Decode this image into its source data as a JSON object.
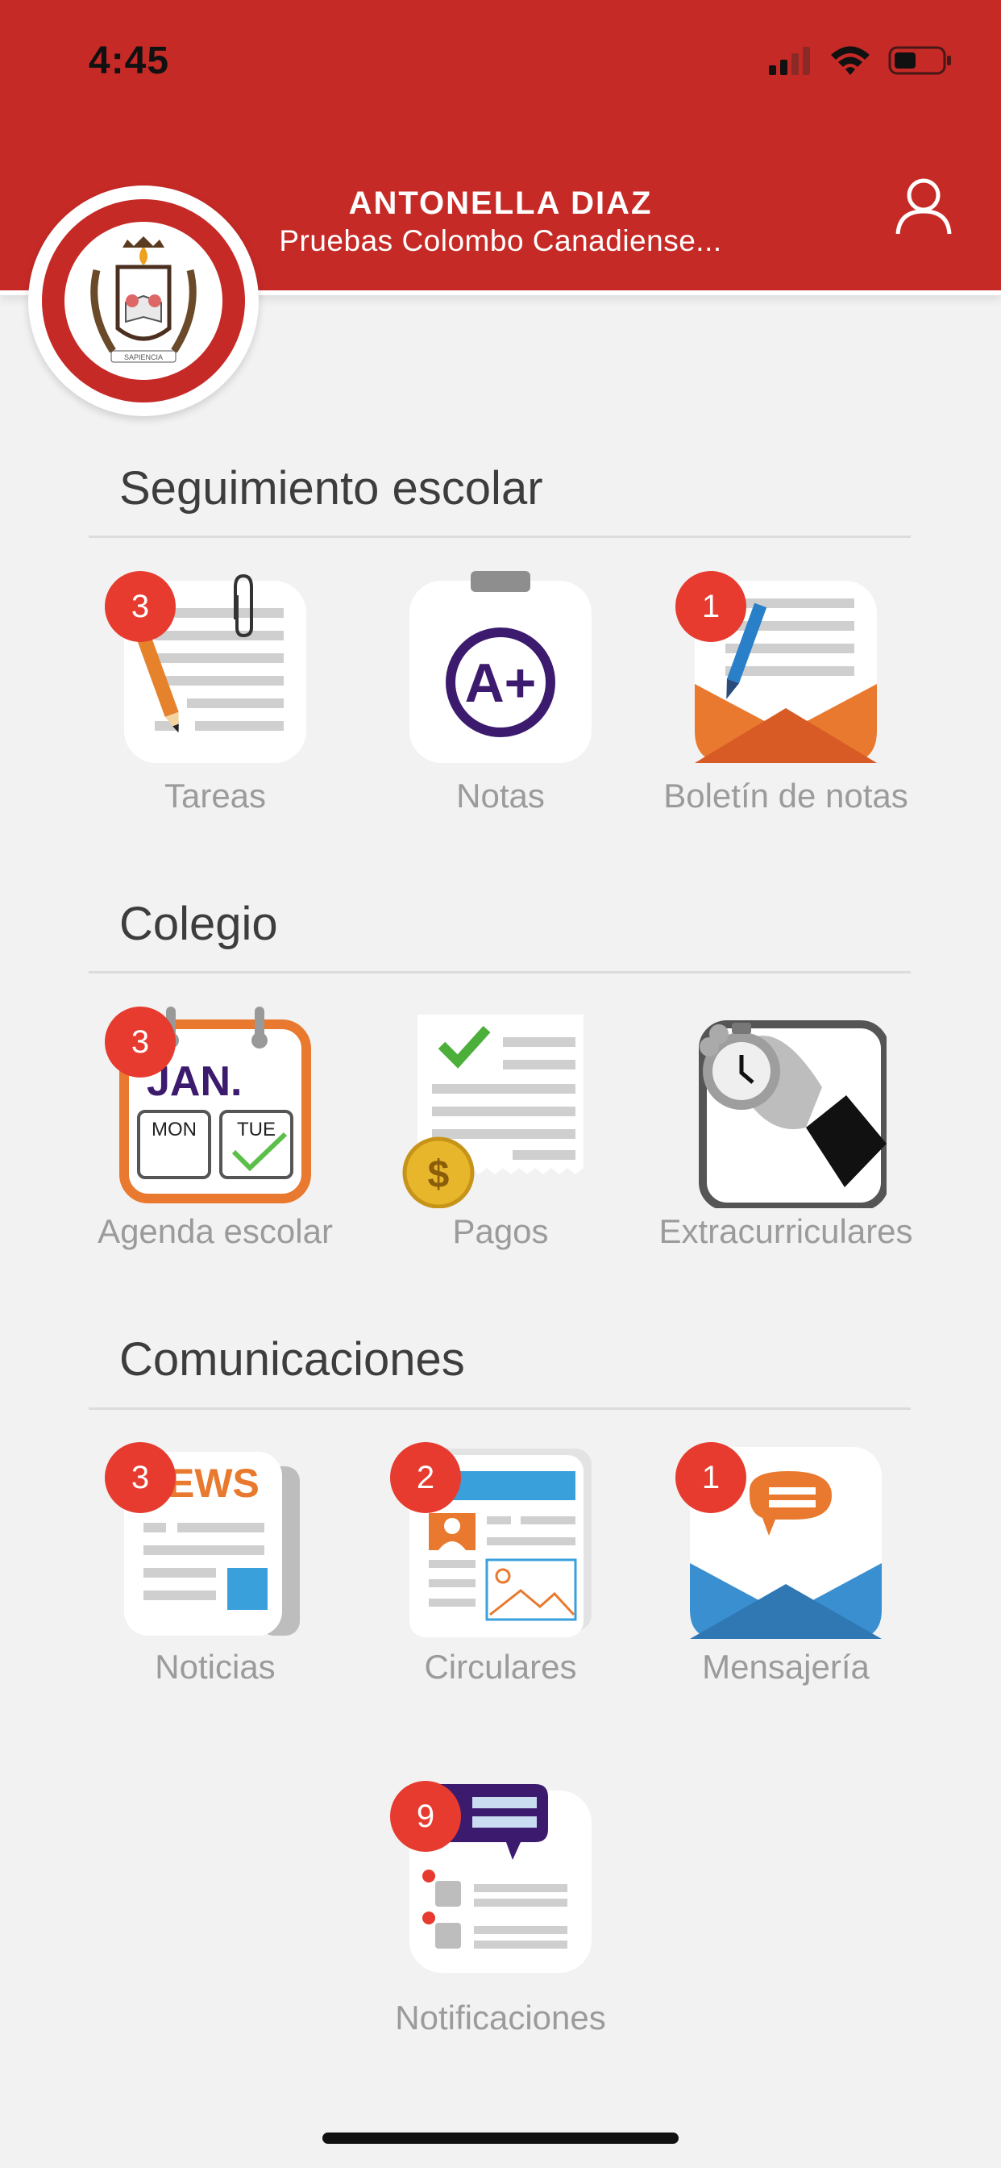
{
  "status": {
    "time": "4:45"
  },
  "header": {
    "user_name": "ANTONELLA  DIAZ",
    "school_name": "Pruebas Colombo Canadiense...",
    "logo_text": "SAPIENCIA"
  },
  "colors": {
    "brand": "#c62a26",
    "badge": "#e63b2e",
    "label": "#9b9b9b"
  },
  "sections": [
    {
      "title": "Seguimiento escolar",
      "items": [
        {
          "label": "Tareas",
          "badge": "3",
          "icon": "homework-icon"
        },
        {
          "label": "Notas",
          "badge": "",
          "icon": "grades-icon"
        },
        {
          "label": "Boletín de notas",
          "badge": "1",
          "icon": "report-card-icon"
        }
      ]
    },
    {
      "title": "Colegio",
      "items": [
        {
          "label": "Agenda escolar",
          "badge": "3",
          "icon": "calendar-icon"
        },
        {
          "label": "Pagos",
          "badge": "",
          "icon": "payments-icon"
        },
        {
          "label": "Extracurriculares",
          "badge": "",
          "icon": "stopwatch-icon"
        }
      ]
    },
    {
      "title": "Comunicaciones",
      "items": [
        {
          "label": "Noticias",
          "badge": "3",
          "icon": "news-icon"
        },
        {
          "label": "Circulares",
          "badge": "2",
          "icon": "circulars-icon"
        },
        {
          "label": "Mensajería",
          "badge": "1",
          "icon": "messaging-icon"
        },
        {
          "label": "Notificaciones",
          "badge": "9",
          "icon": "notifications-icon"
        }
      ]
    }
  ],
  "icon_text": {
    "calendar_month": "JAN.",
    "calendar_day1": "MON",
    "calendar_day2": "TUE",
    "grade": "A+",
    "news": "EWS",
    "currency": "$"
  }
}
